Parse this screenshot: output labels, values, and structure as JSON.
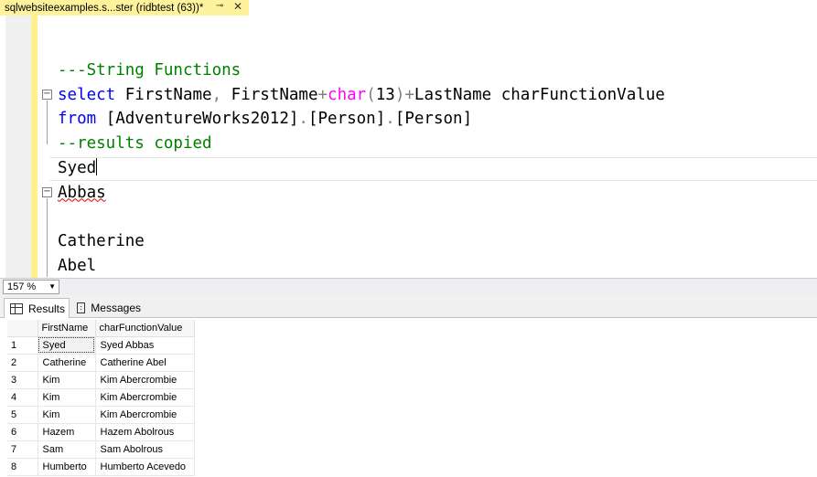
{
  "tab": {
    "title": "sqlwebsiteexamples.s...ster (ridbtest (63))*",
    "pin_icon": "pin-icon",
    "close_icon": "close-icon"
  },
  "editor": {
    "line1_comment": "---String Functions",
    "line2": {
      "kw_select": "select",
      "t1": " FirstName",
      "comma": ",",
      "t2": " FirstName",
      "plus1": "+",
      "fn_char": "char",
      "lparen": "(",
      "num": "13",
      "rparen": ")",
      "plus2": "+",
      "t3": "LastName charFunctionValue"
    },
    "line3": {
      "kw_from": "from",
      "b1": " [AdventureWorks2012]",
      "dot1": ".",
      "b2": "[Person]",
      "dot2": ".",
      "b3": "[Person]"
    },
    "line4_comment": "--results copied",
    "line5": "Syed",
    "line6": "Abbas",
    "line7": "",
    "line8": "Catherine",
    "line9": "Abel"
  },
  "zoom": {
    "value": "157 %"
  },
  "results_tabs": [
    {
      "label": "Results",
      "icon": "grid-icon"
    },
    {
      "label": "Messages",
      "icon": "messages-icon"
    }
  ],
  "grid": {
    "columns": [
      "FirstName",
      "charFunctionValue"
    ],
    "rows": [
      {
        "n": "1",
        "first": "Syed",
        "value": "Syed Abbas"
      },
      {
        "n": "2",
        "first": "Catherine",
        "value": "Catherine Abel"
      },
      {
        "n": "3",
        "first": "Kim",
        "value": "Kim Abercrombie"
      },
      {
        "n": "4",
        "first": "Kim",
        "value": "Kim Abercrombie"
      },
      {
        "n": "5",
        "first": "Kim",
        "value": "Kim Abercrombie"
      },
      {
        "n": "6",
        "first": "Hazem",
        "value": "Hazem Abolrous"
      },
      {
        "n": "7",
        "first": "Sam",
        "value": "Sam Abolrous"
      },
      {
        "n": "8",
        "first": "Humberto",
        "value": "Humberto Acevedo"
      }
    ]
  },
  "colors": {
    "keyword": "#0000ff",
    "function": "#ff00ff",
    "comment": "#008000",
    "tab_active": "#fff29d"
  }
}
